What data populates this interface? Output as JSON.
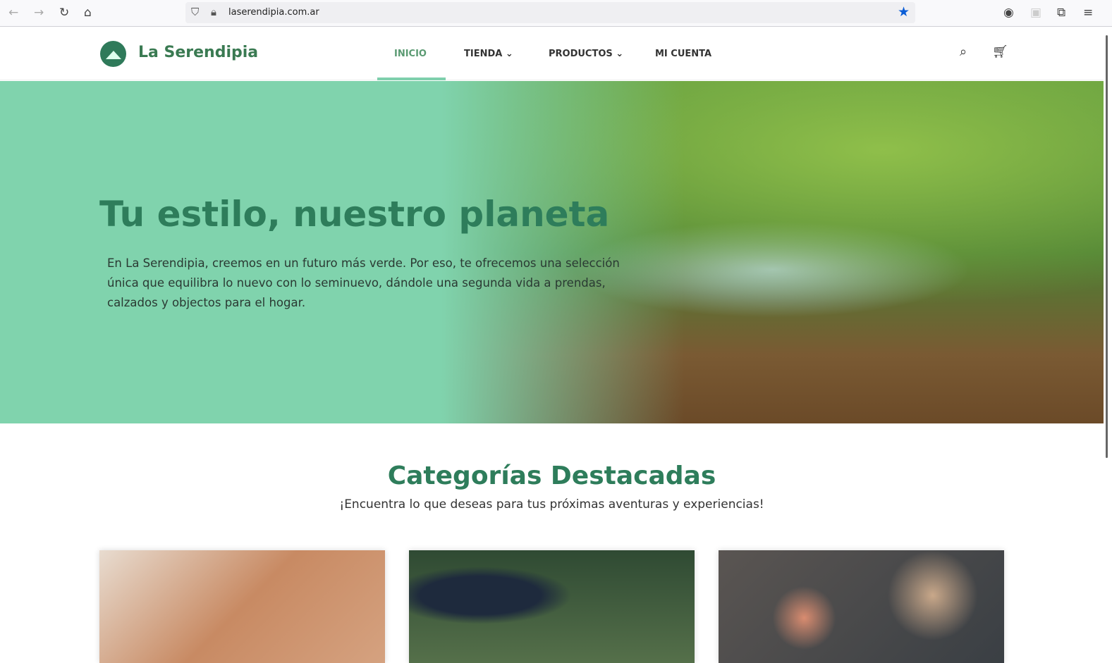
{
  "browser": {
    "url": "laserendipia.com.ar",
    "icons": [
      "back-icon",
      "forward-icon",
      "reload-icon",
      "home-icon",
      "shield-icon",
      "lock-icon",
      "bookmark-star-icon",
      "account-icon",
      "extension-icon",
      "puzzle-icon",
      "menu-icon"
    ]
  },
  "header": {
    "brand": "La Serendipia",
    "nav": [
      {
        "label": "INICIO",
        "active": true
      },
      {
        "label": "TIENDA",
        "dropdown": true
      },
      {
        "label": "PRODUCTOS",
        "dropdown": true
      },
      {
        "label": "MI CUENTA"
      }
    ],
    "icons": [
      "search-icon",
      "cart-icon"
    ]
  },
  "hero": {
    "title": "Tu estilo, nuestro planeta",
    "text": "En La Serendipia, creemos en un futuro más verde. Por eso, te ofrecemos una selección única que equilibra lo nuevo con lo seminuevo, dándole una segunda vida a prendas, calzados y objectos para el hogar."
  },
  "categories": {
    "title": "Categorías Destacadas",
    "subtitle": "¡Encuentra lo que deseas para tus próximas aventuras y experiencias!"
  },
  "colors": {
    "accent": "#2e7d5b",
    "hero_bg": "#80d3ad",
    "brand": "#3a7a52"
  }
}
